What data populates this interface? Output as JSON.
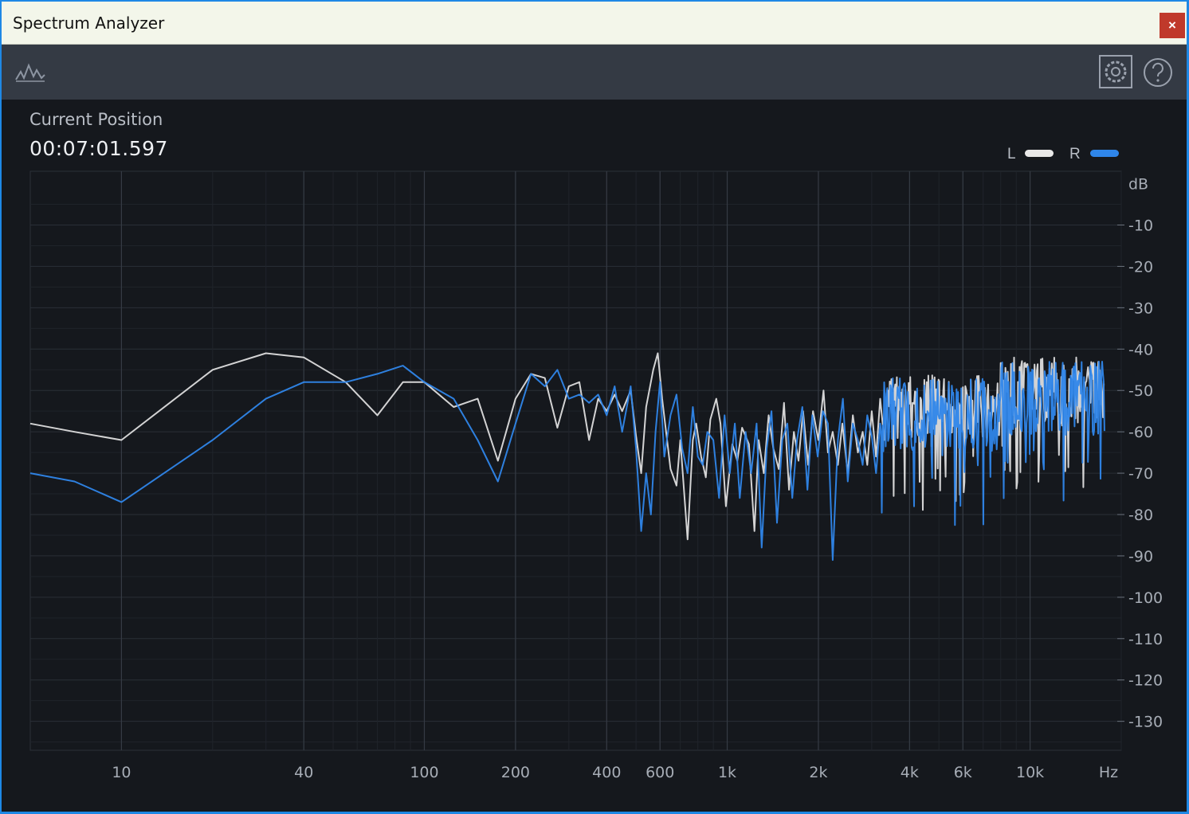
{
  "window": {
    "title": "Spectrum Analyzer",
    "close_label": "×"
  },
  "toolbar": {
    "icons": [
      "spectrum-wave-icon",
      "gear-icon",
      "help-icon"
    ]
  },
  "position": {
    "label": "Current Position",
    "value": "00:07:01.597"
  },
  "legend": [
    {
      "label": "L",
      "color": "#e8e8e8"
    },
    {
      "label": "R",
      "color": "#2f86ea"
    }
  ],
  "chart_data": {
    "type": "line",
    "x_scale": "log",
    "xlim": [
      5,
      20000
    ],
    "ylim": [
      -137,
      3
    ],
    "x_ticks": [
      {
        "value": 10,
        "label": "10"
      },
      {
        "value": 40,
        "label": "40"
      },
      {
        "value": 100,
        "label": "100"
      },
      {
        "value": 200,
        "label": "200"
      },
      {
        "value": 400,
        "label": "400"
      },
      {
        "value": 600,
        "label": "600"
      },
      {
        "value": 1000,
        "label": "1k"
      },
      {
        "value": 2000,
        "label": "2k"
      },
      {
        "value": 4000,
        "label": "4k"
      },
      {
        "value": 6000,
        "label": "6k"
      },
      {
        "value": 10000,
        "label": "10k"
      }
    ],
    "x_unit_label": "Hz",
    "y_unit_label": "dB",
    "y_ticks": [
      {
        "value": -10,
        "label": "-10"
      },
      {
        "value": -20,
        "label": "-20"
      },
      {
        "value": -30,
        "label": "-30"
      },
      {
        "value": -40,
        "label": "-40"
      },
      {
        "value": -50,
        "label": "-50"
      },
      {
        "value": -60,
        "label": "-60"
      },
      {
        "value": -70,
        "label": "-70"
      },
      {
        "value": -80,
        "label": "-80"
      },
      {
        "value": -90,
        "label": "-90"
      },
      {
        "value": -100,
        "label": "-100"
      },
      {
        "value": -110,
        "label": "-110"
      },
      {
        "value": -120,
        "label": "-120"
      },
      {
        "value": -130,
        "label": "-130"
      }
    ],
    "series": [
      {
        "name": "L",
        "color": "#e4e4e4",
        "points": [
          [
            5,
            -58
          ],
          [
            7,
            -60
          ],
          [
            10,
            -62
          ],
          [
            20,
            -45
          ],
          [
            30,
            -41
          ],
          [
            40,
            -42
          ],
          [
            55,
            -48
          ],
          [
            70,
            -56
          ],
          [
            85,
            -48
          ],
          [
            100,
            -48
          ],
          [
            125,
            -54
          ],
          [
            150,
            -52
          ],
          [
            175,
            -67
          ],
          [
            200,
            -52
          ],
          [
            225,
            -46
          ],
          [
            250,
            -47
          ],
          [
            275,
            -59
          ],
          [
            300,
            -49
          ],
          [
            325,
            -48
          ],
          [
            350,
            -62
          ],
          [
            375,
            -52
          ],
          [
            400,
            -55
          ],
          [
            425,
            -51
          ],
          [
            450,
            -55
          ],
          [
            480,
            -50
          ],
          [
            500,
            -61
          ],
          [
            520,
            -70
          ],
          [
            540,
            -54
          ],
          [
            570,
            -45
          ],
          [
            590,
            -41
          ],
          [
            610,
            -52
          ],
          [
            650,
            -69
          ],
          [
            680,
            -73
          ],
          [
            700,
            -62
          ],
          [
            740,
            -86
          ],
          [
            770,
            -62
          ],
          [
            790,
            -58
          ],
          [
            820,
            -66
          ],
          [
            850,
            -71
          ],
          [
            880,
            -57
          ],
          [
            920,
            -52
          ],
          [
            950,
            -58
          ],
          [
            990,
            -78
          ],
          [
            1040,
            -63
          ],
          [
            1080,
            -67
          ],
          [
            1120,
            -59
          ],
          [
            1180,
            -63
          ],
          [
            1230,
            -84
          ],
          [
            1270,
            -62
          ],
          [
            1320,
            -70
          ],
          [
            1370,
            -56
          ],
          [
            1420,
            -64
          ],
          [
            1480,
            -69
          ],
          [
            1540,
            -53
          ],
          [
            1600,
            -74
          ],
          [
            1660,
            -60
          ],
          [
            1720,
            -67
          ],
          [
            1780,
            -55
          ],
          [
            1850,
            -68
          ],
          [
            1920,
            -55
          ],
          [
            2000,
            -62
          ],
          [
            2080,
            -50
          ],
          [
            2150,
            -65
          ],
          [
            2230,
            -60
          ],
          [
            2320,
            -68
          ],
          [
            2400,
            -58
          ],
          [
            2500,
            -70
          ],
          [
            2600,
            -56
          ],
          [
            2700,
            -65
          ],
          [
            2800,
            -60
          ],
          [
            2900,
            -68
          ],
          [
            3000,
            -55
          ],
          [
            3100,
            -66
          ],
          [
            3200,
            -52
          ],
          [
            3300,
            -62
          ],
          [
            3400,
            -50
          ]
        ]
      },
      {
        "name": "R",
        "color": "#2f86ea",
        "points": [
          [
            5,
            -70
          ],
          [
            7,
            -72
          ],
          [
            10,
            -77
          ],
          [
            20,
            -62
          ],
          [
            30,
            -52
          ],
          [
            40,
            -48
          ],
          [
            55,
            -48
          ],
          [
            70,
            -46
          ],
          [
            85,
            -44
          ],
          [
            100,
            -48
          ],
          [
            125,
            -52
          ],
          [
            150,
            -62
          ],
          [
            175,
            -72
          ],
          [
            200,
            -58
          ],
          [
            225,
            -46
          ],
          [
            250,
            -49
          ],
          [
            275,
            -45
          ],
          [
            300,
            -52
          ],
          [
            325,
            -51
          ],
          [
            350,
            -53
          ],
          [
            375,
            -51
          ],
          [
            400,
            -56
          ],
          [
            425,
            -49
          ],
          [
            450,
            -60
          ],
          [
            480,
            -49
          ],
          [
            500,
            -64
          ],
          [
            520,
            -84
          ],
          [
            540,
            -70
          ],
          [
            560,
            -80
          ],
          [
            580,
            -60
          ],
          [
            600,
            -48
          ],
          [
            620,
            -66
          ],
          [
            650,
            -56
          ],
          [
            680,
            -51
          ],
          [
            710,
            -64
          ],
          [
            740,
            -70
          ],
          [
            770,
            -54
          ],
          [
            800,
            -66
          ],
          [
            830,
            -68
          ],
          [
            860,
            -60
          ],
          [
            900,
            -62
          ],
          [
            940,
            -76
          ],
          [
            980,
            -56
          ],
          [
            1020,
            -70
          ],
          [
            1060,
            -58
          ],
          [
            1100,
            -76
          ],
          [
            1150,
            -60
          ],
          [
            1200,
            -70
          ],
          [
            1250,
            -58
          ],
          [
            1300,
            -88
          ],
          [
            1350,
            -64
          ],
          [
            1400,
            -55
          ],
          [
            1460,
            -82
          ],
          [
            1520,
            -62
          ],
          [
            1580,
            -58
          ],
          [
            1640,
            -76
          ],
          [
            1700,
            -62
          ],
          [
            1770,
            -54
          ],
          [
            1840,
            -74
          ],
          [
            1910,
            -56
          ],
          [
            1990,
            -66
          ],
          [
            2070,
            -55
          ],
          [
            2150,
            -58
          ],
          [
            2230,
            -91
          ],
          [
            2320,
            -62
          ],
          [
            2410,
            -52
          ],
          [
            2500,
            -72
          ],
          [
            2600,
            -58
          ],
          [
            2700,
            -62
          ],
          [
            2800,
            -68
          ],
          [
            2900,
            -56
          ],
          [
            3000,
            -61
          ],
          [
            3100,
            -70
          ],
          [
            3200,
            -58
          ]
        ]
      }
    ]
  }
}
